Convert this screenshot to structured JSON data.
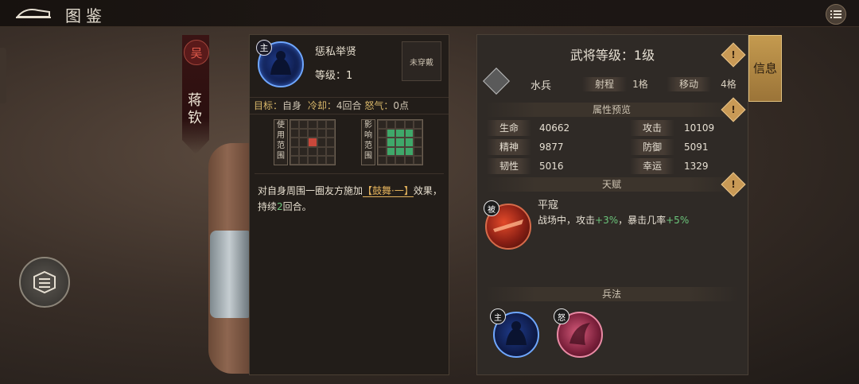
{
  "topbar": {
    "title": "图鉴"
  },
  "hero": {
    "faction": "吴",
    "name": "蒋钦"
  },
  "skill": {
    "type_tag": "主",
    "name": "惩私举贤",
    "level_label": "等级：",
    "level_value": "1",
    "equip_status": "未穿戴",
    "target_label": "目标：",
    "target_value": "自身",
    "cooldown_label": "冷却：",
    "cooldown_value": "4回合",
    "rage_label": "怒气：",
    "rage_value": "0点",
    "use_range_label": "使用范围",
    "effect_range_label": "影响范围",
    "desc_part1": "对自身周围一圈友方施加",
    "desc_highlight": "【鼓舞·一】",
    "desc_part2": "效果，持续",
    "desc_turns": "2",
    "desc_part3": "回合。"
  },
  "info": {
    "tab_label": "信息",
    "level_title": "武将等级：1级",
    "unit_name": "水兵",
    "range_label": "射程",
    "range_value": "1格",
    "move_label": "移动",
    "move_value": "4格",
    "attr_section": "属性预览",
    "stats": [
      {
        "label": "生命",
        "value": "40662"
      },
      {
        "label": "攻击",
        "value": "10109"
      },
      {
        "label": "精神",
        "value": "9877"
      },
      {
        "label": "防御",
        "value": "5091"
      },
      {
        "label": "韧性",
        "value": "5016"
      },
      {
        "label": "幸运",
        "value": "1329"
      }
    ],
    "talent_section": "天赋",
    "talent_tag": "被",
    "talent_name": "平寇",
    "talent_desc1": "战场中，攻击",
    "talent_atk": "+3%",
    "talent_desc2": "，暴击几率",
    "talent_crit": "+5%",
    "tactics_section": "兵法",
    "tactic_tags": [
      "主",
      "怒"
    ],
    "warn_glyph": "!"
  }
}
